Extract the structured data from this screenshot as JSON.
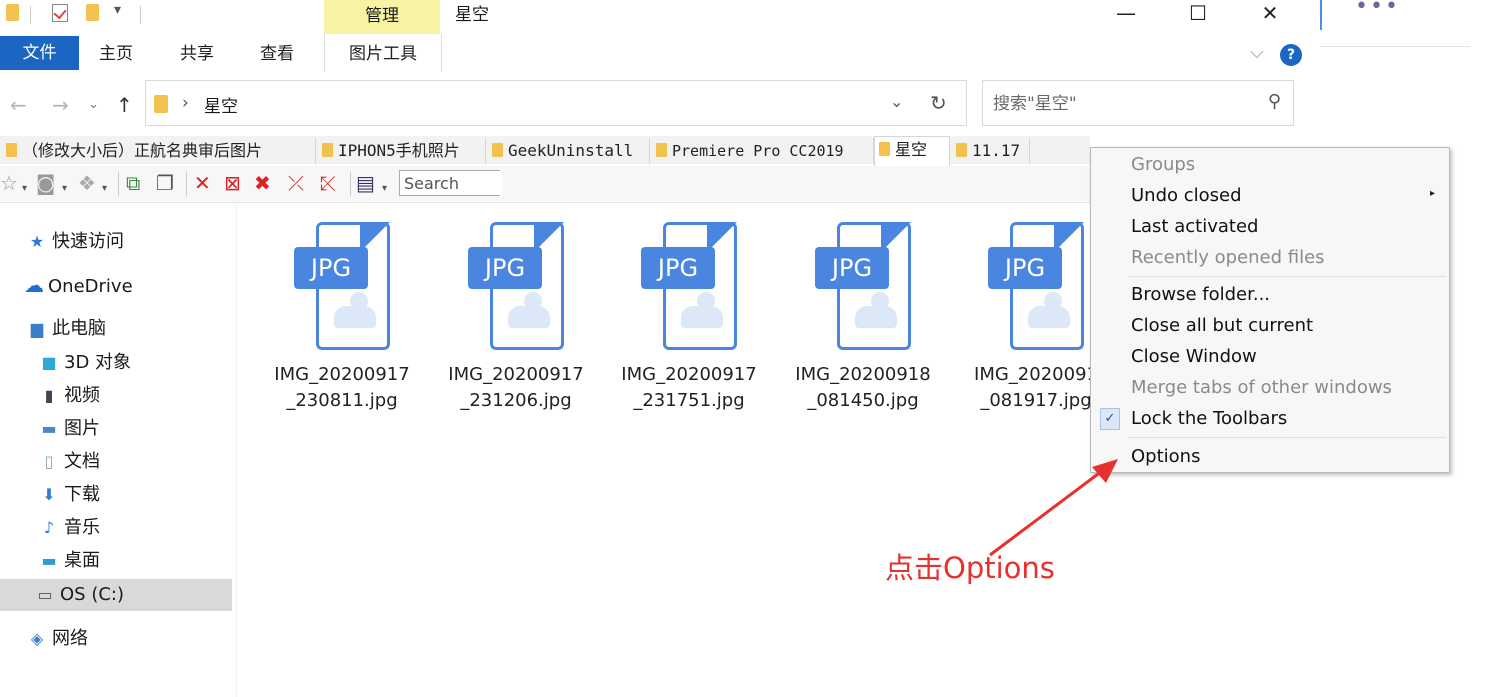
{
  "window": {
    "title": "星空",
    "manage_tab": "管理",
    "controls": {
      "minimize": "—",
      "maximize": "☐",
      "close": "✕"
    }
  },
  "ribbon": {
    "file_tab": "文件",
    "tabs": [
      "主页",
      "共享",
      "查看"
    ],
    "picture_tools_tab": "图片工具",
    "help_label": "?"
  },
  "address": {
    "path": "星空",
    "separator": "›",
    "search_placeholder": "搜索\"星空\""
  },
  "qtabs": [
    {
      "label": "（修改大小后）正航名典审后图片"
    },
    {
      "label": "IPHON5手机照片"
    },
    {
      "label": "GeekUninstall"
    },
    {
      "label": "Premiere Pro CC2019"
    },
    {
      "label": "星空",
      "active": true
    },
    {
      "label": "11.17"
    }
  ],
  "qtoolbar": {
    "search_placeholder": "Search"
  },
  "nav": {
    "items": [
      {
        "label": "快速访问",
        "icon": "star-icon"
      },
      {
        "label": "OneDrive",
        "icon": "cloud-icon"
      },
      {
        "label": "此电脑",
        "icon": "computer-icon"
      },
      {
        "label": "3D 对象",
        "icon": "cube-icon"
      },
      {
        "label": "视频",
        "icon": "film-icon"
      },
      {
        "label": "图片",
        "icon": "picture-icon"
      },
      {
        "label": "文档",
        "icon": "document-icon"
      },
      {
        "label": "下载",
        "icon": "download-icon"
      },
      {
        "label": "音乐",
        "icon": "music-icon"
      },
      {
        "label": "桌面",
        "icon": "desktop-icon"
      },
      {
        "label": "OS (C:)",
        "icon": "drive-icon",
        "selected": true
      },
      {
        "label": "网络",
        "icon": "network-icon"
      }
    ]
  },
  "files": [
    {
      "type": "JPG",
      "name_line1": "IMG_20200917",
      "name_line2": "_230811.jpg"
    },
    {
      "type": "JPG",
      "name_line1": "IMG_20200917",
      "name_line2": "_231206.jpg"
    },
    {
      "type": "JPG",
      "name_line1": "IMG_20200917",
      "name_line2": "_231751.jpg"
    },
    {
      "type": "JPG",
      "name_line1": "IMG_20200918",
      "name_line2": "_081450.jpg"
    },
    {
      "type": "JPG",
      "name_line1": "IMG_2020091",
      "name_line2": "_081917.jpg"
    }
  ],
  "context_menu": {
    "items": [
      {
        "label": "Groups",
        "enabled": false
      },
      {
        "label": "Undo closed",
        "enabled": true,
        "submenu": true
      },
      {
        "label": "Last activated",
        "enabled": true
      },
      {
        "label": "Recently opened files",
        "enabled": false
      },
      {
        "label": "Browse folder...",
        "enabled": true
      },
      {
        "label": "Close all but current",
        "enabled": true
      },
      {
        "label": "Close Window",
        "enabled": true
      },
      {
        "label": "Merge tabs of other windows",
        "enabled": false
      },
      {
        "label": "Lock the Toolbars",
        "enabled": true,
        "checked": true
      },
      {
        "label": "Options",
        "enabled": true
      }
    ],
    "check_mark": "✓",
    "submenu_arrow": "▸"
  },
  "annotation": {
    "text": "点击Options",
    "color": "#e8312f"
  },
  "colors": {
    "accent": "#1a66c2",
    "manage_tab": "#f8f3a2",
    "jpg_icon": "#4a86e0"
  }
}
